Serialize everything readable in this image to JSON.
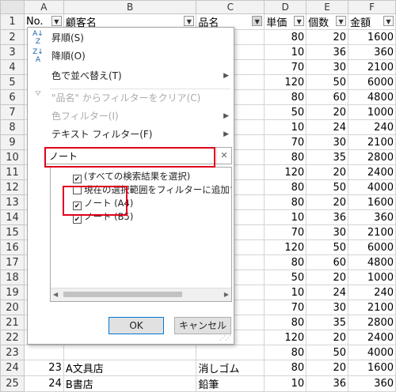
{
  "columns": [
    "A",
    "B",
    "C",
    "D",
    "E",
    "F"
  ],
  "header_row": {
    "row": "1",
    "no": "No.",
    "customer": "顧客名",
    "product": "品名",
    "price": "単価",
    "qty": "個数",
    "amount": "金額"
  },
  "rows": [
    {
      "r": "2",
      "d": "80",
      "e": "20",
      "f": "1600"
    },
    {
      "r": "3",
      "d": "10",
      "e": "36",
      "f": "360"
    },
    {
      "r": "4",
      "d": "70",
      "e": "30",
      "f": "2100"
    },
    {
      "r": "5",
      "d": "120",
      "e": "50",
      "f": "6000"
    },
    {
      "r": "6",
      "d": "80",
      "e": "60",
      "f": "4800"
    },
    {
      "r": "7",
      "d": "50",
      "e": "20",
      "f": "1000"
    },
    {
      "r": "8",
      "d": "10",
      "e": "24",
      "f": "240"
    },
    {
      "r": "9",
      "d": "70",
      "e": "30",
      "f": "2100"
    },
    {
      "r": "10",
      "d": "80",
      "e": "35",
      "f": "2800"
    },
    {
      "r": "11",
      "d": "120",
      "e": "20",
      "f": "2400"
    },
    {
      "r": "12",
      "d": "80",
      "e": "50",
      "f": "4000"
    },
    {
      "r": "13",
      "d": "80",
      "e": "20",
      "f": "1600"
    },
    {
      "r": "14",
      "d": "10",
      "e": "36",
      "f": "360"
    },
    {
      "r": "15",
      "d": "70",
      "e": "30",
      "f": "2100"
    },
    {
      "r": "16",
      "d": "120",
      "e": "50",
      "f": "6000"
    },
    {
      "r": "17",
      "d": "80",
      "e": "60",
      "f": "4800"
    },
    {
      "r": "18",
      "d": "50",
      "e": "20",
      "f": "1000"
    },
    {
      "r": "19",
      "d": "10",
      "e": "24",
      "f": "240"
    },
    {
      "r": "20",
      "d": "70",
      "e": "30",
      "f": "2100"
    },
    {
      "r": "21",
      "d": "80",
      "e": "35",
      "f": "2800"
    },
    {
      "r": "22",
      "d": "120",
      "e": "20",
      "f": "2400"
    },
    {
      "r": "23",
      "d": "80",
      "e": "50",
      "f": "4000"
    },
    {
      "r": "24",
      "a": "23",
      "b": "A文具店",
      "c": "消しゴム",
      "d": "80",
      "e": "20",
      "f": "1600"
    },
    {
      "r": "25",
      "a": "24",
      "b": "B書店",
      "c": "鉛筆",
      "d": "10",
      "e": "36",
      "f": "360"
    }
  ],
  "filter_menu": {
    "sort_asc": "昇順(S)",
    "sort_desc": "降順(O)",
    "sort_by_color": "色で並べ替え(T)",
    "clear_filter": "\"品名\" からフィルターをクリア(C)",
    "color_filter": "色フィルター(I)",
    "text_filter": "テキスト フィルター(F)",
    "search_value": "ノート",
    "list": [
      {
        "label": "(すべての検索結果を選択)",
        "checked": true
      },
      {
        "label": "現在の選択範囲をフィルターに追加す",
        "checked": false
      },
      {
        "label": "ノート (A4)",
        "checked": true
      },
      {
        "label": "ノート (B5)",
        "checked": true
      }
    ],
    "ok": "OK",
    "cancel": "キャンセル"
  },
  "colors": {
    "highlight": "#e0001b",
    "icon_blue": "#1a5fa8"
  }
}
